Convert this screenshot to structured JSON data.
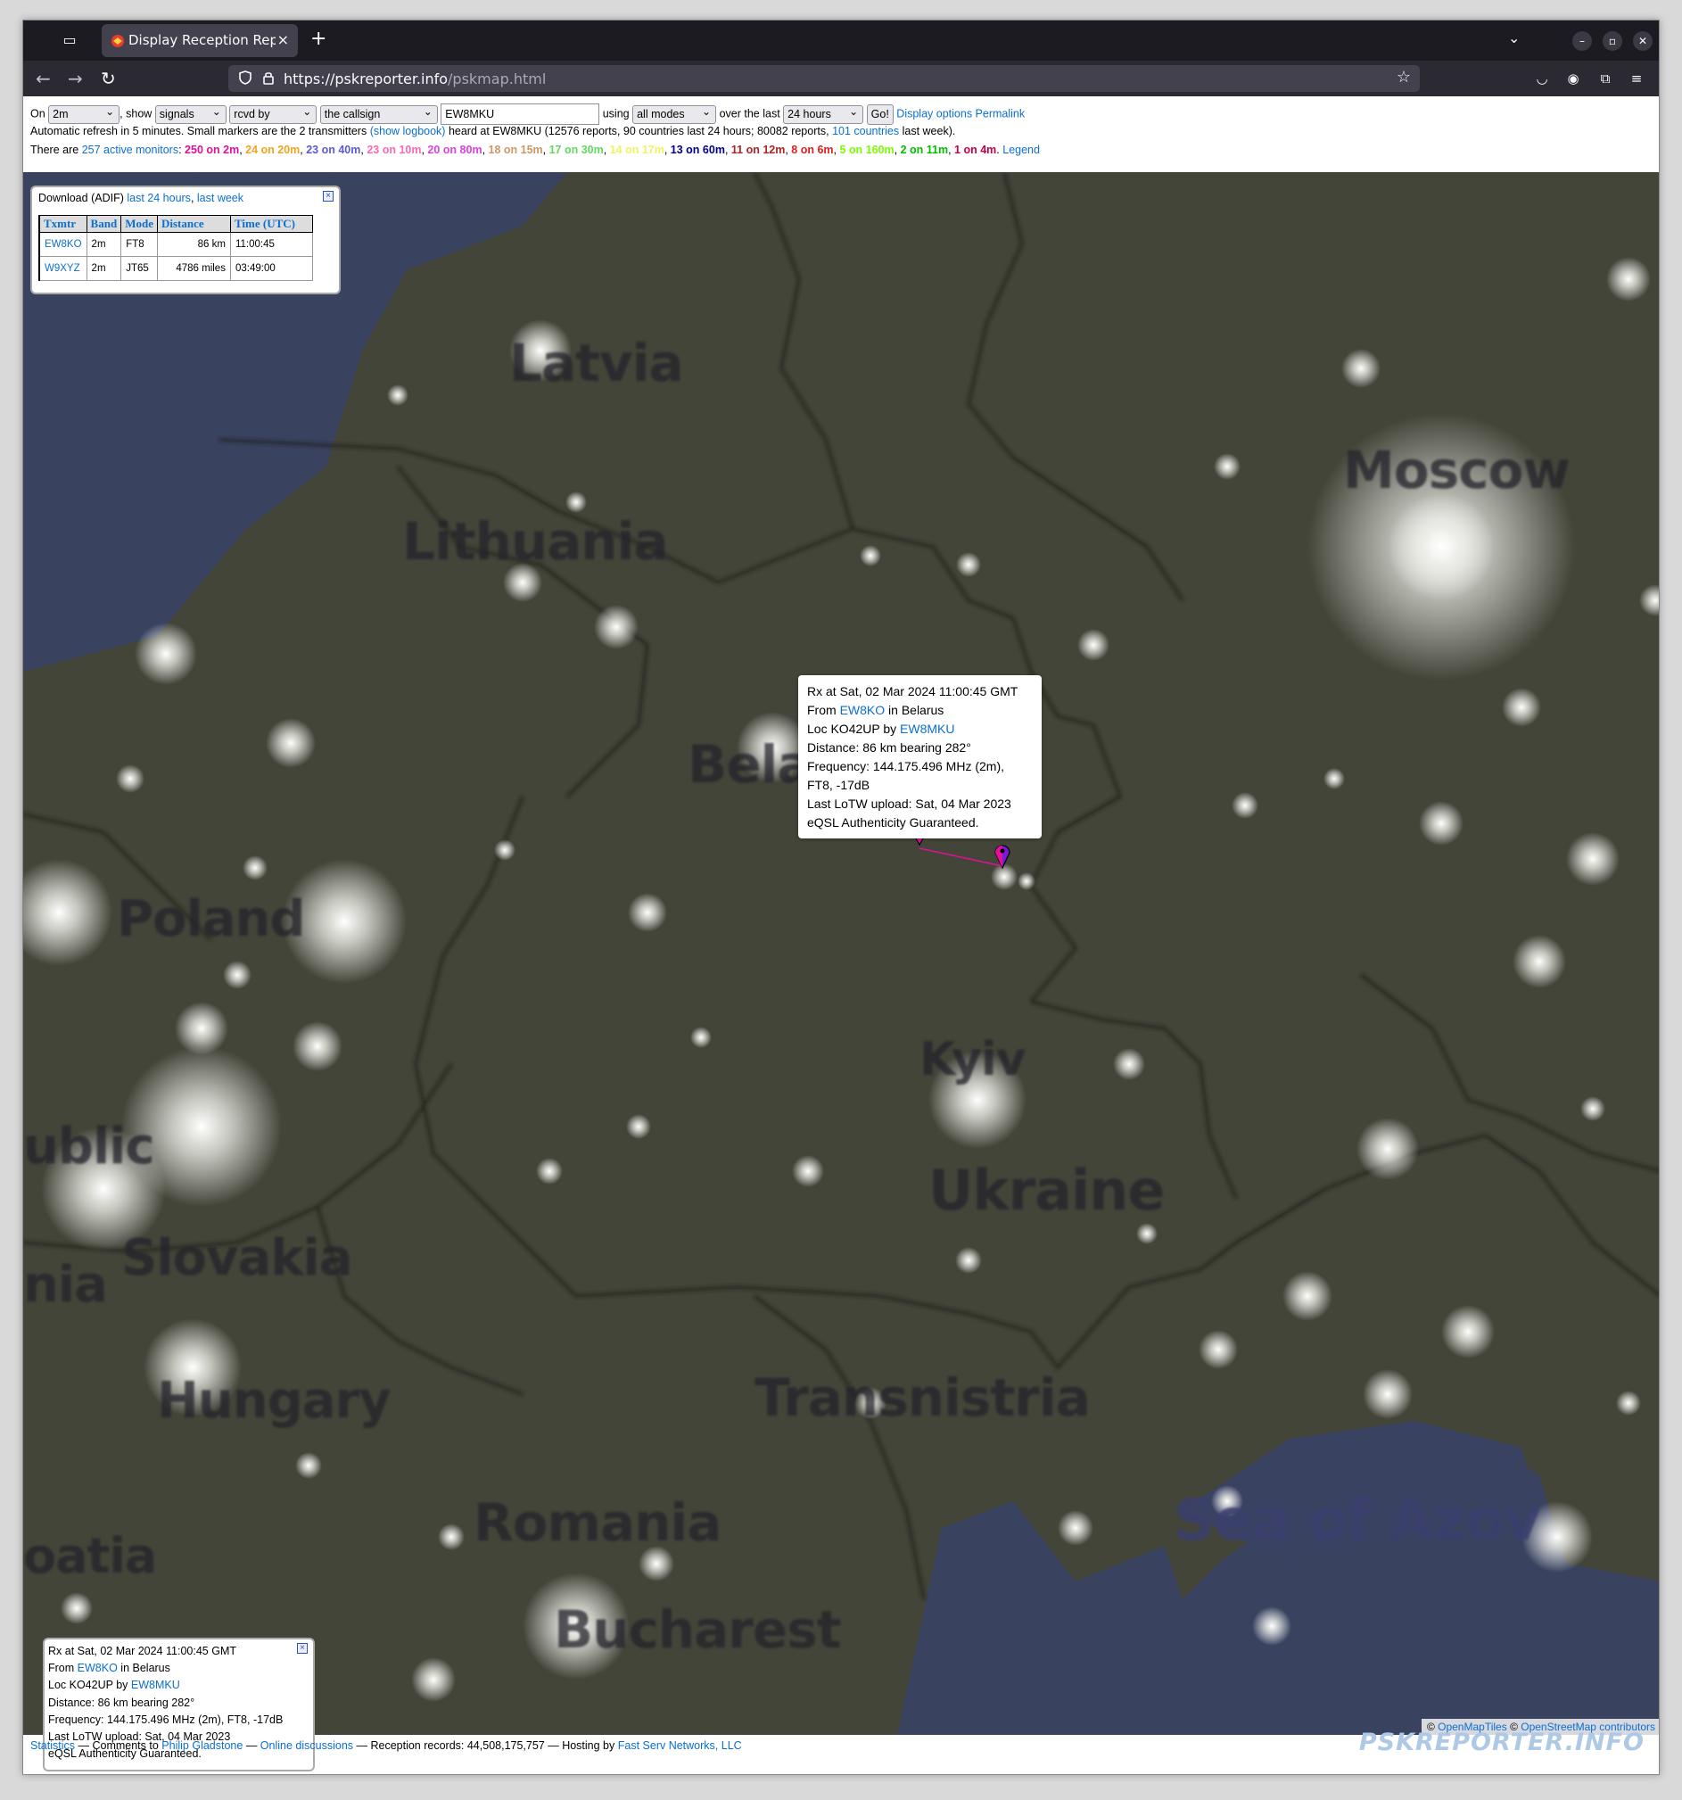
{
  "browser": {
    "tab_title": "Display Reception Report",
    "tab_close": "×",
    "new_tab": "+",
    "url_host": "https://pskreporter.info",
    "url_path": "/pskmap.html"
  },
  "controls": {
    "on_label": "On",
    "band_value": "2m",
    "show_label": ", show",
    "show_value": "signals",
    "direction_value": "rcvd by",
    "target_value": "the callsign",
    "callsign_value": "EW8MKU",
    "using_label": "using",
    "mode_value": "all modes",
    "over_label": "over the last",
    "period_value": "24 hours",
    "go_label": "Go!",
    "display_options": "Display options",
    "permalink": "Permalink",
    "refresh_pre": "Automatic refresh in 5 minutes. Small markers are the 2 transmitters",
    "show_logbook": "(show logbook)",
    "refresh_mid": "heard at EW8MKU (12576 reports, 90 countries last 24 hours; 80082 reports,",
    "countries_link": "101 countries",
    "refresh_post": "last week).",
    "monitors_pre": "There are",
    "monitors_link": "257 active monitors",
    "colon": ":",
    "legend": "Legend",
    "bands": [
      {
        "text": "250 on 2m",
        "color": "#e0109a"
      },
      {
        "text": "24 on 20m",
        "color": "#f2a51c"
      },
      {
        "text": "23 on 40m",
        "color": "#5a5ad8"
      },
      {
        "text": "23 on 10m",
        "color": "#ff69b4"
      },
      {
        "text": "20 on 80m",
        "color": "#e040e0"
      },
      {
        "text": "18 on 15m",
        "color": "#cc9966"
      },
      {
        "text": "17 on 30m",
        "color": "#62d962"
      },
      {
        "text": "14 on 17m",
        "color": "#f2f261"
      },
      {
        "text": "13 on 60m",
        "color": "#00008b"
      },
      {
        "text": "11 on 12m",
        "color": "#b22222"
      },
      {
        "text": "8 on 6m",
        "color": "#e11e1e"
      },
      {
        "text": "5 on 160m",
        "color": "#7cfc00"
      },
      {
        "text": "2 on 11m",
        "color": "#00c000"
      },
      {
        "text": "1 on 4m",
        "color": "#cc0044"
      }
    ]
  },
  "adif": {
    "label": "Download (ADIF)",
    "link_24h": "last 24 hours",
    "comma": ",",
    "link_week": "last week",
    "headers": [
      "Txmtr",
      "Band",
      "Mode",
      "Distance",
      "Time (UTC)"
    ],
    "rows": [
      {
        "tx": "EW8KO",
        "band": "2m",
        "mode": "FT8",
        "distance": "86 km",
        "time": "11:00:45"
      },
      {
        "tx": "W9XYZ",
        "band": "2m",
        "mode": "JT65",
        "distance": "4786 miles",
        "time": "03:49:00"
      }
    ]
  },
  "map_popup": {
    "line1": "Rx at Sat, 02 Mar 2024 11:00:45 GMT",
    "from_label": "From",
    "from_call": "EW8KO",
    "from_country": "in Belarus",
    "loc_label": "Loc KO42UP by",
    "loc_call": "EW8MKU",
    "distance": "Distance: 86 km bearing 282°",
    "frequency": "Frequency: 144.175.496 MHz (2m),",
    "mode": "FT8, -17dB",
    "lotw": "Last LoTW upload: Sat, 04 Mar 2023",
    "eqsl": "eQSL Authenticity Guaranteed."
  },
  "bottom_popup": {
    "line1": "Rx at Sat, 02 Mar 2024 11:00:45 GMT",
    "from_label": "From",
    "from_call": "EW8KO",
    "from_country": "in Belarus",
    "loc_label": "Loc KO42UP by",
    "loc_call": "EW8MKU",
    "distance": "Distance: 86 km bearing 282°",
    "frequency": "Frequency: 144.175.496 MHz (2m), FT8, -17dB",
    "lotw": "Last LoTW upload: Sat, 04 Mar 2023",
    "eqsl": "eQSL Authenticity Guaranteed."
  },
  "map_labels": {
    "latvia": "Latvia",
    "lithuania": "Lithuania",
    "moscow": "Moscow",
    "belarus": "Bela",
    "poland": "Poland",
    "kyiv": "Kyiv",
    "ukraine": "Ukraine",
    "slovakia": "Slovakia",
    "hungary": "Hungary",
    "transnistria": "Transnistria",
    "romania": "Romania",
    "bucharest": "Bucharest",
    "sea_of_azov": "Sea of Azov",
    "left_cut1": "ublic",
    "left_cut2": "oatia",
    "left_cut3": "nia"
  },
  "attribution": {
    "copy1": "©",
    "omt": "OpenMapTiles",
    "copy2": "©",
    "osm": "OpenStreetMap contributors"
  },
  "footer": {
    "statistics": "Statistics",
    "comments": "— Comments to",
    "author": "Philip Gladstone",
    "dash1": "—",
    "online": "Online discussions",
    "records": "— Reception records: 44,508,175,757 — Hosting by",
    "host": "Fast Serv Networks, LLC",
    "logo": "PSKREPORTER.INFO"
  }
}
